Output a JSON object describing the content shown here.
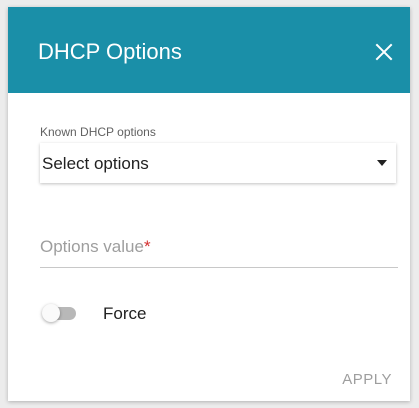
{
  "dialog": {
    "title": "DHCP Options",
    "header_color": "#1a8fa8",
    "close_icon": "close-icon"
  },
  "known_options": {
    "label": "Known DHCP options",
    "selected": "Select options"
  },
  "options_value": {
    "placeholder": "Options value",
    "required_marker": "*",
    "value": ""
  },
  "force": {
    "label": "Force",
    "enabled": false
  },
  "actions": {
    "apply_label": "APPLY"
  }
}
